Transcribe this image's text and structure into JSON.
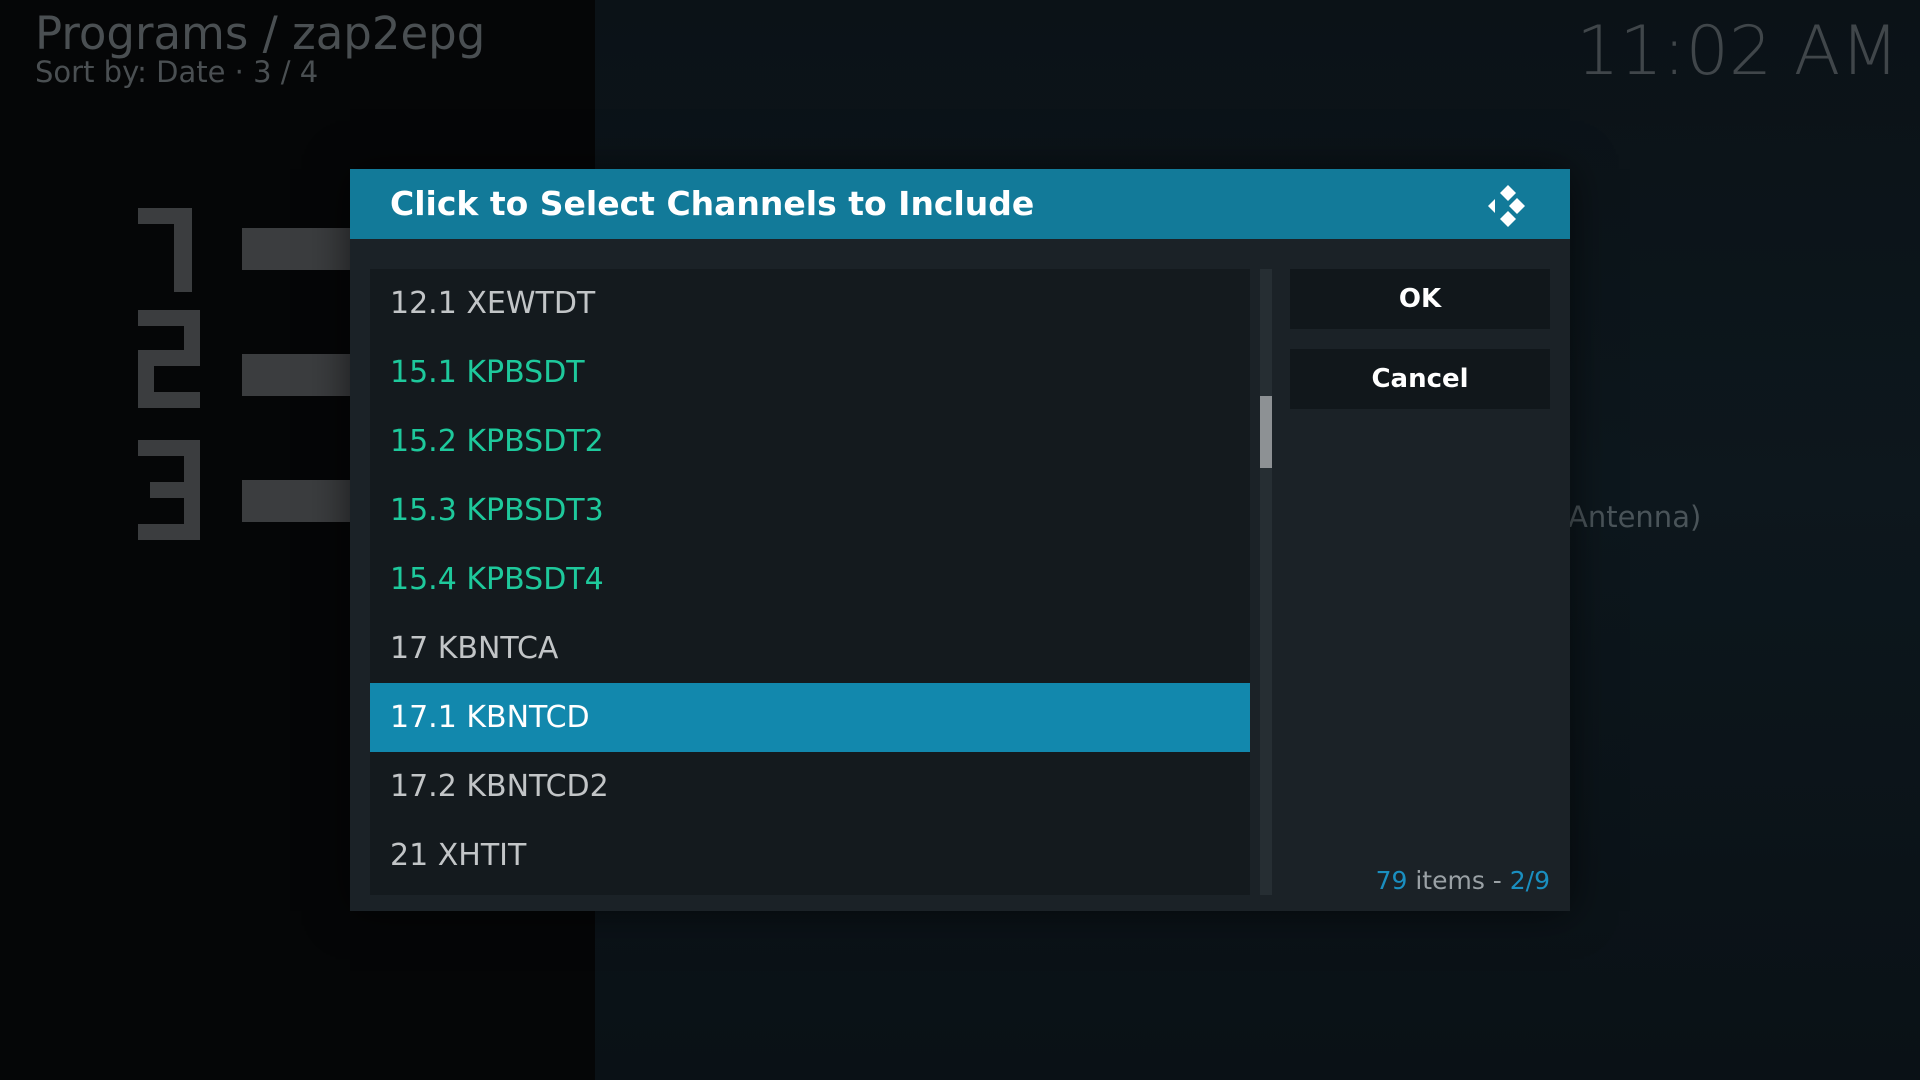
{
  "header": {
    "breadcrumb": "Programs / zap2epg",
    "sort_info": "Sort by: Date  ·  3 / 4",
    "clock": "11:02 AM"
  },
  "background": {
    "partial_label": "Antenna)"
  },
  "dialog": {
    "title": "Click to Select Channels to Include",
    "items": [
      {
        "label": "12.1 XEWTDT",
        "selected": false
      },
      {
        "label": "15.1 KPBSDT",
        "selected": true
      },
      {
        "label": "15.2 KPBSDT2",
        "selected": true
      },
      {
        "label": "15.3 KPBSDT3",
        "selected": true
      },
      {
        "label": "15.4 KPBSDT4",
        "selected": true
      },
      {
        "label": "17 KBNTCA",
        "selected": false
      },
      {
        "label": "17.1 KBNTCD",
        "selected": false,
        "focused": true
      },
      {
        "label": "17.2 KBNTCD2",
        "selected": false
      },
      {
        "label": "21 XHTIT",
        "selected": false
      }
    ],
    "ok_label": "OK",
    "cancel_label": "Cancel",
    "count": {
      "items": "79",
      "items_word": " items - ",
      "page": "2/9"
    }
  },
  "scroll": {
    "page_fraction": 0.222
  },
  "colors": {
    "header": "#127a99",
    "focus": "#1288ad",
    "selected_text": "#1ec99c",
    "unselected_text": "#c2c5c7",
    "accent": "#1a8fc0"
  },
  "icons": [
    "kodi-logo-icon"
  ]
}
